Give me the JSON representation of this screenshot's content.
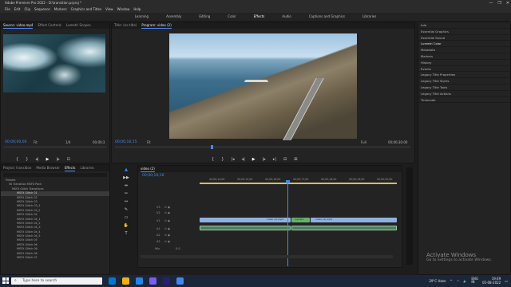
{
  "app": {
    "title": "Adobe Premiere Pro 2022 - D:\\transition.prproj *",
    "window_controls": [
      "—",
      "❐",
      "✕"
    ]
  },
  "menu": [
    "File",
    "Edit",
    "Clip",
    "Sequence",
    "Markers",
    "Graphics and Titles",
    "View",
    "Window",
    "Help"
  ],
  "workspaces": {
    "items": [
      "Learning",
      "Assembly",
      "Editing",
      "Color",
      "Effects",
      "Audio",
      "Captions and Graphics",
      "Libraries"
    ],
    "active": "Effects"
  },
  "source_panel": {
    "tabs": [
      "Source: video.mp4",
      "Effect Controls",
      "Lumetri Scopes"
    ],
    "timecode": "00;00;00;00",
    "fit": "Fit",
    "ratio": "1/4",
    "duration": "00;00;3"
  },
  "program_panel": {
    "tabs": [
      "Title: (no title)",
      "Program: video (2)"
    ],
    "timecode": "00;00;16;15",
    "fit": "Fit",
    "quality": "Full",
    "duration": "00;00;30;00"
  },
  "project_panel": {
    "tabs": [
      "Project: transition",
      "Media Browser",
      "Effects",
      "Libraries"
    ],
    "tree": [
      {
        "label": "Presets",
        "level": 0
      },
      {
        "label": "50 Transition MSFX Pack",
        "level": 1
      },
      {
        "label": "MSFX Glitch Transitions",
        "level": 2
      }
    ],
    "items": [
      "MSFX Glitch 01",
      "MSFX Glitch 02",
      "MSFX Glitch 03",
      "MSFX Glitch 03_1",
      "MSFX Glitch 03_2",
      "MSFX Glitch 04",
      "MSFX Glitch 04_1",
      "MSFX Glitch 04_2",
      "MSFX Glitch 04_3",
      "MSFX Glitch 04_4",
      "MSFX Glitch 04_5",
      "MSFX Glitch 05",
      "MSFX Glitch 06",
      "MSFX Glitch 06",
      "MSFX Glitch 06",
      "MSFX Glitch 07"
    ]
  },
  "timeline": {
    "tab": "video (2)",
    "timecode": "00;00;16;16",
    "ruler": [
      "00;00;14;00",
      "00;00;15;00",
      "00;00;16;00",
      "00;00;17;00",
      "00;00;18;00",
      "00;00;19;00",
      "00;00;20;00"
    ],
    "tracks": [
      "V3",
      "V2",
      "V1",
      "A1",
      "A2",
      "A3"
    ],
    "master": "Mix",
    "master_value": "0.0",
    "clips": [
      {
        "label": "video (1).mp4",
        "color": "#8fb0e0"
      },
      {
        "label": "Lumetri",
        "color": "#66b06a"
      },
      {
        "label": "video (2).mp4",
        "color": "#8fb0e0"
      }
    ]
  },
  "right_panel": {
    "items": [
      "Info",
      "Essential Graphics",
      "Essential Sound",
      "Lumetri Color",
      "Metadata",
      "Markers",
      "History",
      "Events",
      "Legacy Title Properties",
      "Legacy Title Styles",
      "Legacy Title Tools",
      "Legacy Title Actions",
      "Timecode"
    ],
    "active": "Lumetri Color"
  },
  "watermark": {
    "line1": "Activate Windows",
    "line2": "Go to Settings to activate Windows."
  },
  "taskbar": {
    "search_placeholder": "Type here to search",
    "weather": "29°C Haze",
    "language": "ENG\nIN",
    "time": "19:49",
    "date": "05-08-2022",
    "icon_colors": [
      "#0078d4",
      "#f2b300",
      "#1e88e5",
      "#7a5af8",
      "#2b1b7a",
      "#4285f4"
    ]
  }
}
